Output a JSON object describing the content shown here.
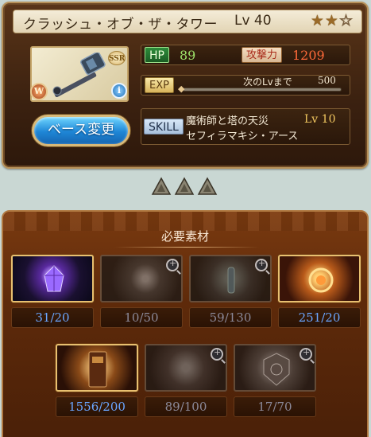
{
  "weapon": {
    "name": "クラッシュ・オブ・ザ・タワー",
    "level_label": "Lv 40",
    "rarity_badge": "SSR",
    "element_badge": "W",
    "info_badge": "i",
    "stars_filled": 2,
    "stars_total": 3,
    "star_glyphs": [
      "★",
      "★",
      "☆"
    ]
  },
  "base_change_button": "ベース変更",
  "stats": {
    "hp_label": "HP",
    "hp_value": "89",
    "attack_label": "攻撃力",
    "attack_value": "1209"
  },
  "exp": {
    "label": "EXP",
    "next_label": "次のLvまで",
    "next_value": "500",
    "progress": 0.0
  },
  "skill": {
    "label": "SKILL",
    "line1": "魔術師と塔の天災",
    "line2": "セフィラマキシ・アース",
    "level": "Lv 10"
  },
  "uncap_count": 3,
  "materials_panel": {
    "title": "必要素材",
    "items": [
      {
        "id": "mat-1",
        "count": "31/20",
        "enough": true,
        "zoom": false,
        "art": "purple-crystal"
      },
      {
        "id": "mat-2",
        "count": "10/50",
        "enough": false,
        "zoom": true,
        "art": "dark-burst"
      },
      {
        "id": "mat-3",
        "count": "59/130",
        "enough": false,
        "zoom": true,
        "art": "blue-vial"
      },
      {
        "id": "mat-4",
        "count": "251/20",
        "enough": true,
        "zoom": false,
        "art": "gold-ring"
      },
      {
        "id": "mat-5",
        "count": "1556/200",
        "enough": true,
        "zoom": false,
        "art": "old-book"
      },
      {
        "id": "mat-6",
        "count": "89/100",
        "enough": false,
        "zoom": true,
        "art": "grey-scroll"
      },
      {
        "id": "mat-7",
        "count": "17/70",
        "enough": false,
        "zoom": true,
        "art": "silver-emblem"
      }
    ]
  },
  "colors": {
    "count_enough": "#6aa6ff",
    "count_lacking": "#8c8a9a",
    "hp": "#9ee26a",
    "attack": "#ff6a3a"
  }
}
